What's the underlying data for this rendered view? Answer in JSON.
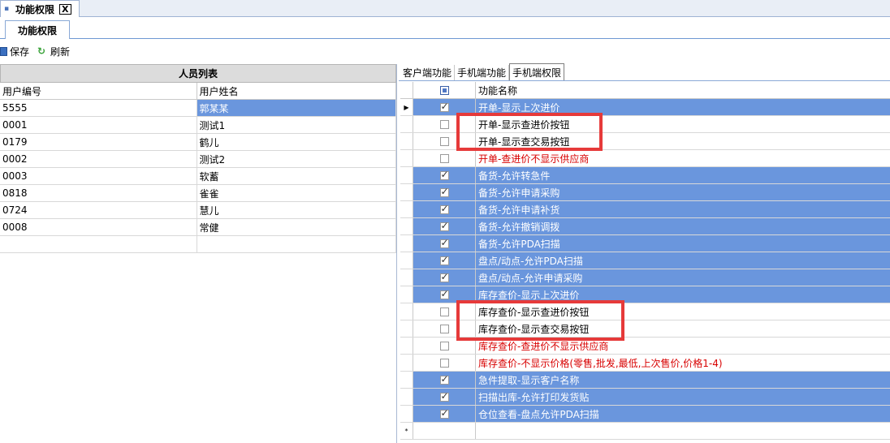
{
  "doc_tab": {
    "title": "功能权限",
    "close": "X"
  },
  "sub_tab": {
    "title": "功能权限"
  },
  "toolbar": {
    "save": "保存",
    "refresh": "刷新"
  },
  "left": {
    "title": "人员列表",
    "headers": [
      "用户编号",
      "用户姓名"
    ],
    "rows": [
      [
        "5555",
        "郭某某"
      ],
      [
        "0001",
        "测试1"
      ],
      [
        "0179",
        "鹤儿"
      ],
      [
        "0002",
        "测试2"
      ],
      [
        "0003",
        "软蓄"
      ],
      [
        "0818",
        "雀雀"
      ],
      [
        "0724",
        "慧儿"
      ],
      [
        "0008",
        "常健"
      ]
    ]
  },
  "right": {
    "tabs": [
      "客户端功能",
      "手机端功能",
      "手机端权限"
    ],
    "header": "功能名称",
    "new_row_marker": "*",
    "rows": [
      {
        "name": "开单-显示上次进价",
        "checked": true,
        "selected": true,
        "red": false
      },
      {
        "name": "开单-显示查进价按钮",
        "checked": false,
        "selected": false,
        "red": false
      },
      {
        "name": "开单-显示查交易按钮",
        "checked": false,
        "selected": false,
        "red": false
      },
      {
        "name": "开单-查进价不显示供应商",
        "checked": false,
        "selected": false,
        "red": true
      },
      {
        "name": "备货-允许转急件",
        "checked": true,
        "selected": true,
        "red": false
      },
      {
        "name": "备货-允许申请采购",
        "checked": true,
        "selected": true,
        "red": false
      },
      {
        "name": "备货-允许申请补货",
        "checked": true,
        "selected": true,
        "red": false
      },
      {
        "name": "备货-允许撤销调拨",
        "checked": true,
        "selected": true,
        "red": false
      },
      {
        "name": "备货-允许PDA扫描",
        "checked": true,
        "selected": true,
        "red": false
      },
      {
        "name": "盘点/动点-允许PDA扫描",
        "checked": true,
        "selected": true,
        "red": false
      },
      {
        "name": "盘点/动点-允许申请采购",
        "checked": true,
        "selected": true,
        "red": false
      },
      {
        "name": "库存查价-显示上次进价",
        "checked": true,
        "selected": true,
        "red": false
      },
      {
        "name": "库存查价-显示查进价按钮",
        "checked": false,
        "selected": false,
        "red": false
      },
      {
        "name": "库存查价-显示查交易按钮",
        "checked": false,
        "selected": false,
        "red": false
      },
      {
        "name": "库存查价-查进价不显示供应商",
        "checked": false,
        "selected": false,
        "red": true
      },
      {
        "name": "库存查价-不显示价格(零售,批发,最低,上次售价,价格1-4)",
        "checked": false,
        "selected": false,
        "red": true
      },
      {
        "name": "急件提取-显示客户名称",
        "checked": true,
        "selected": true,
        "red": false
      },
      {
        "name": "扫描出库-允许打印发货贴",
        "checked": true,
        "selected": true,
        "red": false
      },
      {
        "name": "仓位查看-盘点允许PDA扫描",
        "checked": true,
        "selected": true,
        "red": false
      }
    ]
  },
  "colors": {
    "selection": "#6a96dd",
    "warning_text": "#d80000",
    "highlight_box": "#e63a3a"
  }
}
